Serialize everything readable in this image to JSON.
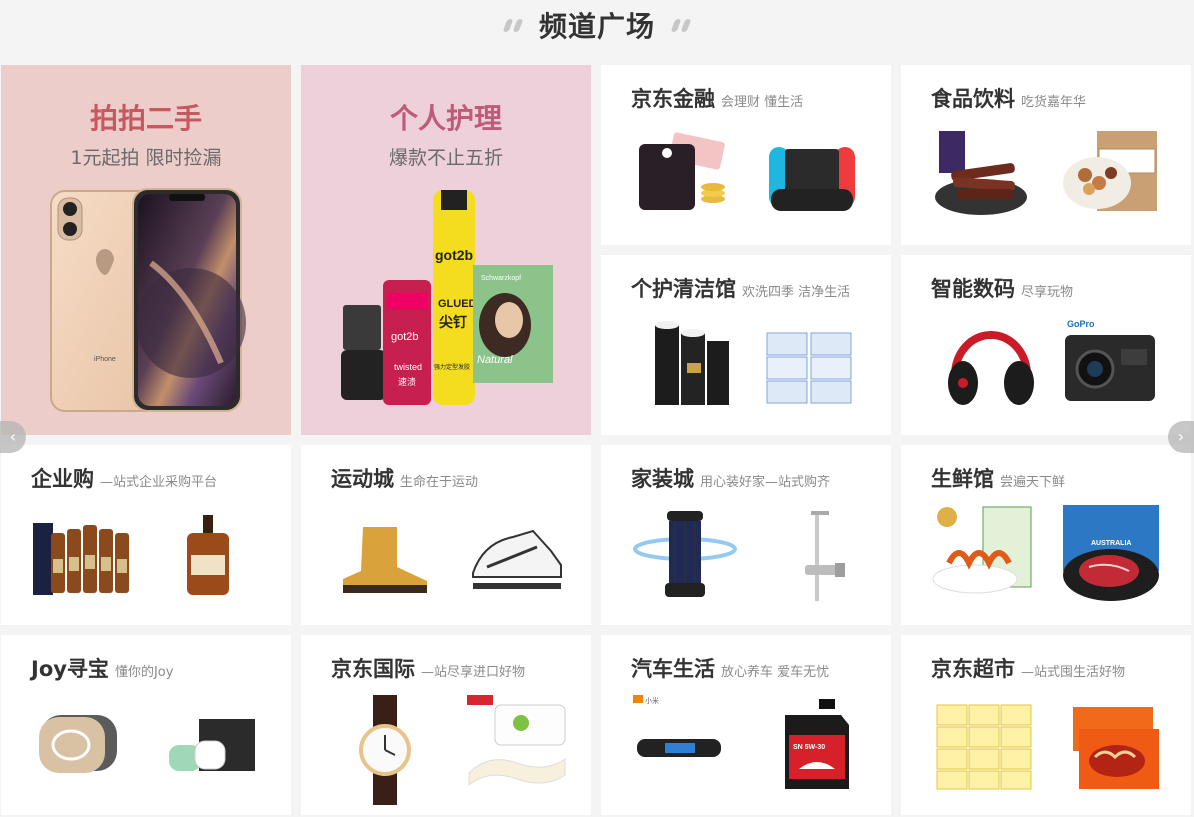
{
  "header": {
    "title": "频道广场"
  },
  "promos": [
    {
      "title": "拍拍二手",
      "subtitle": "1元起拍 限时捡漏",
      "product_label": "iPhone"
    },
    {
      "title": "个人护理",
      "subtitle": "爆款不止五折",
      "product_labels": [
        "got2b",
        "GLUED",
        "尖钉",
        "Schwarzkopf",
        "Natural",
        "twisted",
        "速溃",
        "强力定型发胶"
      ]
    }
  ],
  "tiles": [
    {
      "name": "京东金融",
      "desc": "会理财 懂生活"
    },
    {
      "name": "食品饮料",
      "desc": "吃货嘉年华"
    },
    {
      "name": "个护清洁馆",
      "desc": "欢洗四季 洁净生活"
    },
    {
      "name": "智能数码",
      "desc": "尽享玩物",
      "product_label": "GoPro"
    },
    {
      "name": "企业购",
      "desc": "—站式企业采购平台"
    },
    {
      "name": "运动城",
      "desc": "生命在于运动"
    },
    {
      "name": "家装城",
      "desc": "用心装好家—站式购齐"
    },
    {
      "name": "生鲜馆",
      "desc": "尝遍天下鲜",
      "product_label": "AUSTRALIA"
    },
    {
      "name": "Joy寻宝",
      "desc": "懂你的Joy"
    },
    {
      "name": "京东国际",
      "desc": "—站尽享进口好物"
    },
    {
      "name": "汽车生活",
      "desc": "放心养车 爱车无忧",
      "product_labels": [
        "小米",
        "SN 5W-30"
      ]
    },
    {
      "name": "京东超市",
      "desc": "—站式囤生活好物"
    }
  ],
  "carousel": {
    "prev_icon": "chevron-left-icon",
    "next_icon": "chevron-right-icon"
  },
  "colors": {
    "background": "#f4f4f4",
    "promo1_bg": "#edcdc9",
    "promo2_bg": "#eed0da",
    "promo1_title": "#c55860",
    "promo2_title": "#bf5a78"
  }
}
